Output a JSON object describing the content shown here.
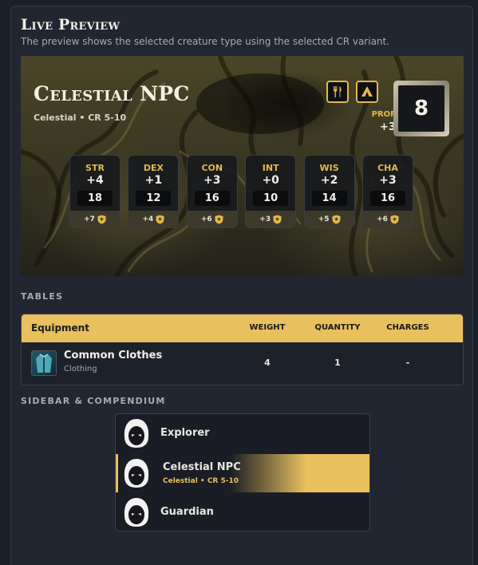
{
  "header": {
    "title": "Live Preview",
    "subtitle": "The preview shows the selected creature type using the selected CR variant."
  },
  "creature": {
    "name": "Celestial NPC",
    "subtitle": "Celestial • CR 5-10",
    "icons": [
      "utensils-icon",
      "tent-icon"
    ],
    "prof_label": "PROF",
    "prof_value": "+3",
    "level": "8"
  },
  "stats": [
    {
      "name": "STR",
      "mod": "+4",
      "score": "18",
      "save": "+7"
    },
    {
      "name": "DEX",
      "mod": "+1",
      "score": "12",
      "save": "+4"
    },
    {
      "name": "CON",
      "mod": "+3",
      "score": "16",
      "save": "+6"
    },
    {
      "name": "INT",
      "mod": "+0",
      "score": "10",
      "save": "+3"
    },
    {
      "name": "WIS",
      "mod": "+2",
      "score": "14",
      "save": "+5"
    },
    {
      "name": "CHA",
      "mod": "+3",
      "score": "16",
      "save": "+6"
    }
  ],
  "tables": {
    "section_label": "TABLES",
    "headers": [
      "Equipment",
      "WEIGHT",
      "QUANTITY",
      "CHARGES"
    ],
    "rows": [
      {
        "name": "Common Clothes",
        "type": "Clothing",
        "weight": "4",
        "quantity": "1",
        "charges": "-"
      }
    ]
  },
  "sidebar": {
    "section_label": "SIDEBAR & COMPENDIUM",
    "items": [
      {
        "name": "Explorer",
        "sub": ""
      },
      {
        "name": "Celestial NPC",
        "sub": "Celestial • CR 5-10"
      },
      {
        "name": "Guardian",
        "sub": ""
      }
    ]
  },
  "colors": {
    "accent": "#e8c05e",
    "background": "#1b1f27",
    "panel": "#212631"
  }
}
